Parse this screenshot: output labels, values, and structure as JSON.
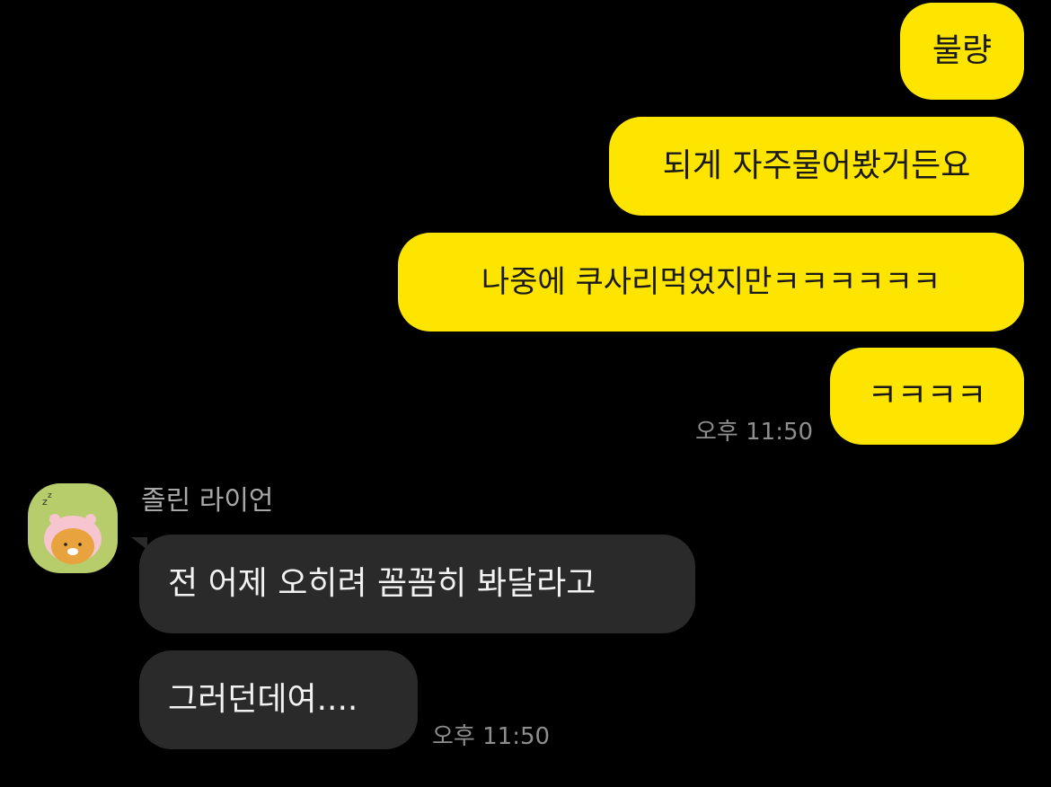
{
  "outgoing": [
    {
      "text": "불량"
    },
    {
      "text": "되게 자주물어봤거든요"
    },
    {
      "text": "나중에 쿠사리먹었지만ㅋㅋㅋㅋㅋㅋ"
    },
    {
      "text": "ㅋㅋㅋㅋ"
    }
  ],
  "outgoing_time": "오후 11:50",
  "incoming": {
    "sender": "졸린 라이언",
    "avatar_icon": "sleepy-ryan-icon",
    "messages": [
      {
        "text": "전 어제 오히려 꼼꼼히 봐달라고"
      },
      {
        "text": "그러던데여...."
      }
    ],
    "time": "오후 11:50"
  },
  "colors": {
    "background": "#000000",
    "outgoing_bubble": "#FEE500",
    "incoming_bubble": "#2A2A2A",
    "avatar_bg": "#B7CC6A"
  }
}
